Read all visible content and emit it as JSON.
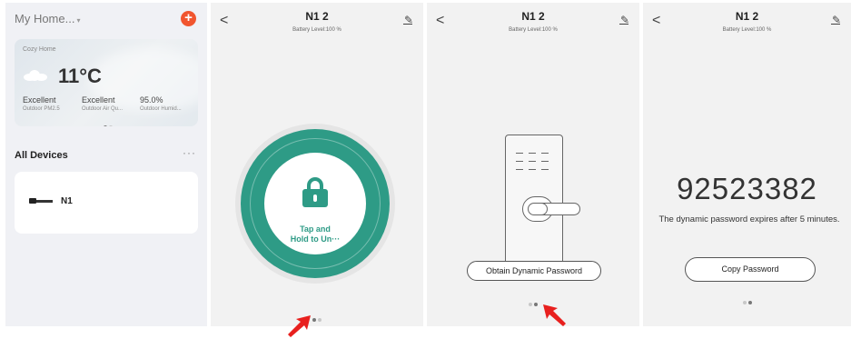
{
  "home": {
    "title": "My Home...",
    "caret": "▾",
    "add_icon": "+",
    "weather": {
      "home_name": "Cozy Home",
      "temperature": "11°C",
      "stats": [
        {
          "value": "Excellent",
          "label": "Outdoor PM2.5"
        },
        {
          "value": "Excellent",
          "label": "Outdoor Air Qu..."
        },
        {
          "value": "95.0%",
          "label": "Outdoor Humid..."
        }
      ]
    },
    "all_devices_label": "All Devices",
    "more_icon": "···",
    "device": {
      "name": "N1"
    }
  },
  "lock": {
    "title": "N1 2",
    "battery": "Battery Level:100 %",
    "back_icon": "<",
    "edit_icon": "✎"
  },
  "unlock": {
    "tap_line1": "Tap and",
    "tap_line2": "Hold to Un···"
  },
  "dynamic": {
    "obtain_label": "Obtain Dynamic Password"
  },
  "password": {
    "value": "92523382",
    "note": "The dynamic password expires after 5 minutes.",
    "copy_label": "Copy Password"
  },
  "colors": {
    "accent": "#2e9b86",
    "add_button": "#f1552f",
    "arrow": "#e8201e"
  }
}
